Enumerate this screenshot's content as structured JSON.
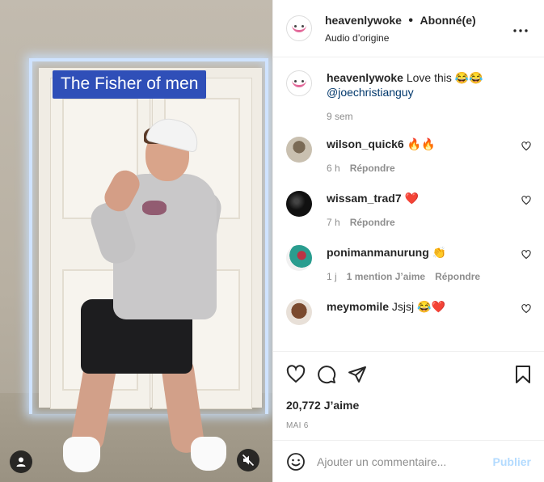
{
  "video": {
    "overlay_text": "The Fisher of men"
  },
  "header": {
    "username": "heavenlywoke",
    "separator": "•",
    "follow_status": "Abonné(e)",
    "audio": "Audio d’origine",
    "more_icon": "more-horizontal-icon"
  },
  "caption": {
    "username": "heavenlywoke",
    "text": " Love this 😂😂",
    "mention": "@joechristianguy",
    "time": "9 sem"
  },
  "comments": [
    {
      "username": "wilson_quick6",
      "text": " 🔥🔥",
      "time": "6 h",
      "likes": "",
      "reply": "Répondre"
    },
    {
      "username": "wissam_trad7",
      "text": " ❤️",
      "time": "7 h",
      "likes": "",
      "reply": "Répondre"
    },
    {
      "username": "ponimanmanurung",
      "text": " 👏",
      "time": "1 j",
      "likes": "1 mention J’aime",
      "reply": "Répondre"
    },
    {
      "username": "meymomile",
      "text": " Jsjsj 😂❤️",
      "time": "",
      "likes": "",
      "reply": ""
    }
  ],
  "actions": {
    "likes": "20,772 J’aime",
    "date": "MAI 6"
  },
  "add_comment": {
    "placeholder": "Ajouter un commentaire...",
    "publish": "Publier"
  },
  "colors": {
    "link": "#00376b",
    "publish_disabled": "#b3dbff",
    "meta": "#8e8e8e",
    "caption_box": "#2f4fb8"
  }
}
